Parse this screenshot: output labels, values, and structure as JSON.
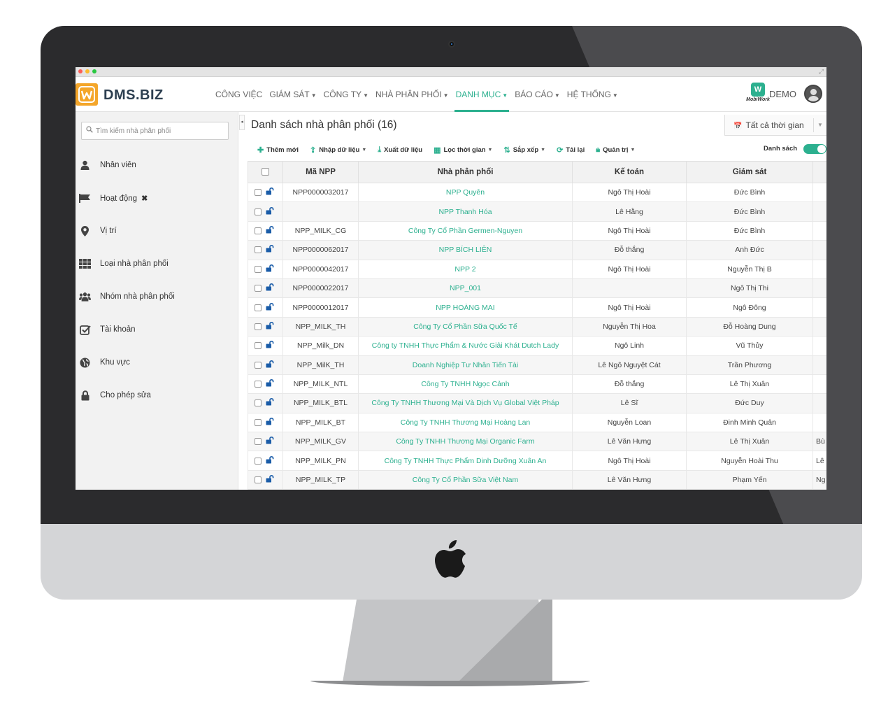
{
  "app": {
    "brand": "DMS.BIZ",
    "brand_colors": {
      "accent": "#2cb08f",
      "logo": "#f4a62a",
      "text": "#2c3e50"
    }
  },
  "nav": {
    "items": [
      {
        "label": "CÔNG VIỆC",
        "has_menu": false
      },
      {
        "label": "GIÁM SÁT",
        "has_menu": true
      },
      {
        "label": "CÔNG TY",
        "has_menu": true
      },
      {
        "label": "NHÀ PHÂN PHỐI",
        "has_menu": true
      },
      {
        "label": "DANH MỤC",
        "has_menu": true,
        "active": true
      },
      {
        "label": "BÁO CÁO",
        "has_menu": true
      },
      {
        "label": "HỆ THỐNG",
        "has_menu": true
      }
    ],
    "mobiwork_label": "MobiWork",
    "user": "DEMO"
  },
  "sidebar": {
    "search_placeholder": "Tìm kiếm nhà phân phối",
    "items": [
      {
        "label": "Nhân viên",
        "icon": "user-icon"
      },
      {
        "label": "Hoạt động",
        "icon": "flag-icon",
        "closable": true
      },
      {
        "label": "Vị trí",
        "icon": "map-marker-icon"
      },
      {
        "label": "Loại nhà phân phối",
        "icon": "grid-icon"
      },
      {
        "label": "Nhóm nhà phân phối",
        "icon": "users-icon"
      },
      {
        "label": "Tài khoản",
        "icon": "checkbox-icon"
      },
      {
        "label": "Khu vực",
        "icon": "globe-icon"
      },
      {
        "label": "Cho phép sửa",
        "icon": "lock-icon"
      }
    ]
  },
  "main": {
    "title": "Danh sách nhà phân phối (16)",
    "time_filter": "Tất cả thời gian",
    "toolbar": {
      "add": "Thêm mới",
      "import": "Nhập dữ liệu",
      "export": "Xuất dữ liệu",
      "time": "Lọc thời gian",
      "sort": "Sắp xếp",
      "reload": "Tải lại",
      "admin": "Quản trị",
      "view": "Danh sách"
    },
    "columns": [
      "Mã NPP",
      "Nhà phân phối",
      "Kế toán",
      "Giám sát"
    ],
    "rows": [
      {
        "code": "NPP0000032017",
        "name": "NPP Quyên",
        "accountant": "Ngô Thị Hoài",
        "supervisor": "Đức Bình",
        "extra": ""
      },
      {
        "code": "",
        "name": "NPP Thanh Hóa",
        "accountant": "Lê Hằng",
        "supervisor": "Đức Bình",
        "extra": ""
      },
      {
        "code": "NPP_MILK_CG",
        "name": "Công Ty Cổ Phần Germen-Nguyen",
        "accountant": "Ngô Thị Hoài",
        "supervisor": "Đức Bình",
        "extra": ""
      },
      {
        "code": "NPP0000062017",
        "name": "NPP BÍCH LIÊN",
        "accountant": "Đỗ thắng",
        "supervisor": "Anh Đức",
        "extra": ""
      },
      {
        "code": "NPP0000042017",
        "name": "NPP 2",
        "accountant": "Ngô Thị Hoài",
        "supervisor": "Nguyễn Thị B",
        "extra": ""
      },
      {
        "code": "NPP0000022017",
        "name": "NPP_001",
        "accountant": "",
        "supervisor": "Ngô Thị Thi",
        "extra": ""
      },
      {
        "code": "NPP0000012017",
        "name": "NPP HOÀNG MAI",
        "accountant": "Ngô Thị Hoài",
        "supervisor": "Ngô Đông",
        "extra": ""
      },
      {
        "code": "NPP_MILK_TH",
        "name": "Công Ty Cổ Phần Sữa Quốc Tế",
        "accountant": "Nguyễn Thị Hoa",
        "supervisor": "Đỗ Hoàng Dung",
        "extra": ""
      },
      {
        "code": "NPP_Milk_DN",
        "name": "Công ty TNHH Thực Phẩm & Nước Giải Khát Dutch Lady",
        "accountant": "Ngô Linh",
        "supervisor": "Vũ Thủy",
        "extra": ""
      },
      {
        "code": "NPP_MilK_TH",
        "name": "Doanh Nghiệp Tư Nhân Tiến Tài",
        "accountant": "Lê Ngô Nguyệt Cát",
        "supervisor": "Trần Phương",
        "extra": ""
      },
      {
        "code": "NPP_MILK_NTL",
        "name": "Công Ty TNHH Ngọc Cảnh",
        "accountant": "Đỗ thắng",
        "supervisor": "Lê Thị Xuân",
        "extra": ""
      },
      {
        "code": "NPP_MILK_BTL",
        "name": "Công Ty TNHH Thương Mại Và Dịch Vụ Global Việt Pháp",
        "accountant": "Lê Sĩ",
        "supervisor": "Đức Duy",
        "extra": ""
      },
      {
        "code": "NPP_MILK_BT",
        "name": "Công Ty TNHH Thương Mại Hoàng Lan",
        "accountant": "Nguyễn Loan",
        "supervisor": "Đinh Minh Quân",
        "extra": ""
      },
      {
        "code": "NPP_MILK_GV",
        "name": "Công Ty TNHH Thương Mại Organic Farm",
        "accountant": "Lê Văn Hưng",
        "supervisor": "Lê Thị Xuân",
        "extra": "Bù"
      },
      {
        "code": "NPP_MILK_PN",
        "name": "Công Ty TNHH Thực Phẩm Dinh Dưỡng Xuân An",
        "accountant": "Ngô Thị Hoài",
        "supervisor": "Nguyễn Hoài Thu",
        "extra": "Lê"
      },
      {
        "code": "NPP_MILK_TP",
        "name": "Công Ty Cổ Phần Sữa Việt Nam",
        "accountant": "Lê Văn Hưng",
        "supervisor": "Phạm Yến",
        "extra": "Ng"
      }
    ]
  }
}
